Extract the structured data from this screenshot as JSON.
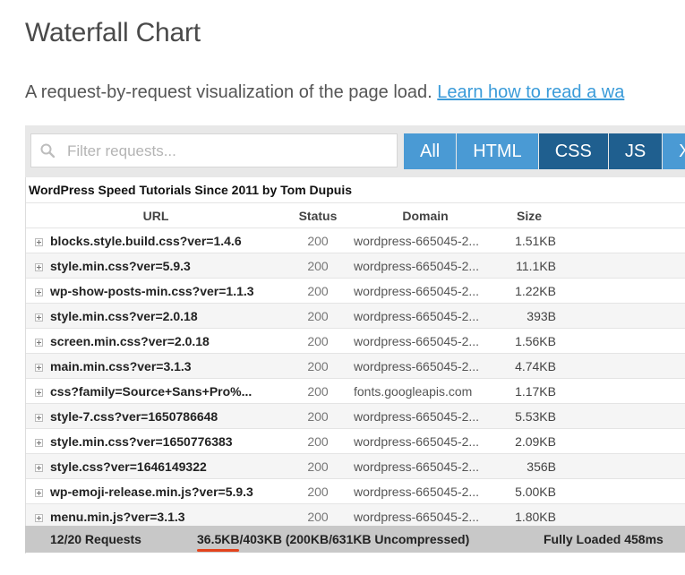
{
  "title": "Waterfall Chart",
  "subtitle": {
    "text": "A request-by-request visualization of the page load.",
    "link": "Learn how to read a wa"
  },
  "search": {
    "placeholder": "Filter requests...",
    "value": ""
  },
  "tabs": [
    {
      "label": "All",
      "active": false
    },
    {
      "label": "HTML",
      "active": false
    },
    {
      "label": "CSS",
      "active": true
    },
    {
      "label": "JS",
      "active": true
    },
    {
      "label": "XH",
      "active": false
    }
  ],
  "table": {
    "caption": "WordPress Speed Tutorials Since 2011 by Tom Dupuis",
    "headers": {
      "url": "URL",
      "status": "Status",
      "domain": "Domain",
      "size": "Size"
    },
    "rows": [
      {
        "url": "blocks.style.build.css?ver=1.4.6",
        "status": "200",
        "domain": "wordpress-665045-2...",
        "size": "1.51KB"
      },
      {
        "url": "style.min.css?ver=5.9.3",
        "status": "200",
        "domain": "wordpress-665045-2...",
        "size": "11.1KB"
      },
      {
        "url": "wp-show-posts-min.css?ver=1.1.3",
        "status": "200",
        "domain": "wordpress-665045-2...",
        "size": "1.22KB"
      },
      {
        "url": "style.min.css?ver=2.0.18",
        "status": "200",
        "domain": "wordpress-665045-2...",
        "size": "393B"
      },
      {
        "url": "screen.min.css?ver=2.0.18",
        "status": "200",
        "domain": "wordpress-665045-2...",
        "size": "1.56KB"
      },
      {
        "url": "main.min.css?ver=3.1.3",
        "status": "200",
        "domain": "wordpress-665045-2...",
        "size": "4.74KB"
      },
      {
        "url": "css?family=Source+Sans+Pro%...",
        "status": "200",
        "domain": "fonts.googleapis.com",
        "size": "1.17KB"
      },
      {
        "url": "style-7.css?ver=1650786648",
        "status": "200",
        "domain": "wordpress-665045-2...",
        "size": "5.53KB"
      },
      {
        "url": "style.min.css?ver=1650776383",
        "status": "200",
        "domain": "wordpress-665045-2...",
        "size": "2.09KB"
      },
      {
        "url": "style.css?ver=1646149322",
        "status": "200",
        "domain": "wordpress-665045-2...",
        "size": "356B"
      },
      {
        "url": "wp-emoji-release.min.js?ver=5.9.3",
        "status": "200",
        "domain": "wordpress-665045-2...",
        "size": "5.00KB"
      },
      {
        "url": "menu.min.js?ver=3.1.3",
        "status": "200",
        "domain": "wordpress-665045-2...",
        "size": "1.80KB"
      }
    ]
  },
  "footer": {
    "requests": "12/20 Requests",
    "size_highlight": "36.5KB",
    "size_rest": "/403KB  (200KB/631KB Uncompressed)",
    "loaded": "Fully Loaded 458ms"
  },
  "colors": {
    "tab": "#4a9ad4",
    "tab_active": "#1f5f8f",
    "link": "#3a9bd9",
    "underline": "#e4431c"
  }
}
